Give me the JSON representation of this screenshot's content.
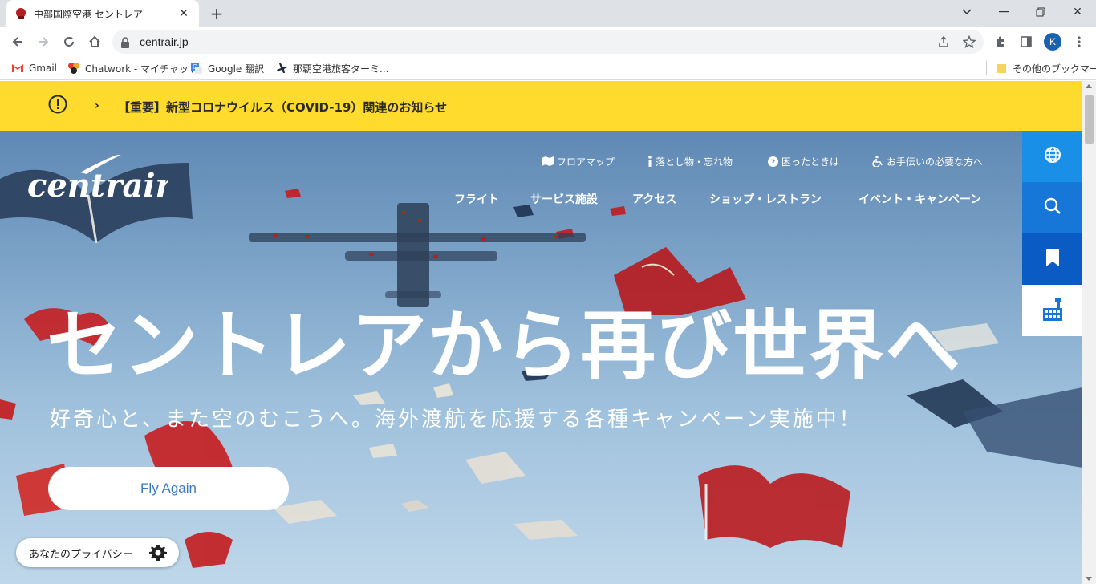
{
  "browser": {
    "tab_title": "中部国際空港 セントレア",
    "url": "centrair.jp",
    "profile_initial": "K"
  },
  "bookmarks": {
    "items": [
      {
        "label": "Gmail"
      },
      {
        "label": "Chatwork - マイチャット"
      },
      {
        "label": "Google 翻訳"
      },
      {
        "label": "那覇空港旅客ターミ..."
      }
    ],
    "other_label": "その他のブックマーク"
  },
  "notice": {
    "text": "【重要】新型コロナウイルス（COVID-19）関連のお知らせ"
  },
  "header": {
    "logo_text": "centrair",
    "utility_links": [
      {
        "label": "フロアマップ"
      },
      {
        "label": "落とし物・忘れ物"
      },
      {
        "label": "困ったときは"
      },
      {
        "label": "お手伝いの必要な方へ"
      }
    ],
    "main_nav": [
      {
        "label": "フライト"
      },
      {
        "label": "サービス施設"
      },
      {
        "label": "アクセス"
      },
      {
        "label": "ショップ・レストラン"
      },
      {
        "label": "イベント・キャンペーン"
      }
    ]
  },
  "hero": {
    "headline": "セントレアから再び世界へ",
    "subline": "好奇心と、また空のむこうへ。海外渡航を応援する各種キャンペーン実施中！",
    "cta_label": "Fly Again"
  },
  "privacy": {
    "label": "あなたのプライバシー"
  },
  "colors": {
    "notice_bg": "#fedb2c",
    "side_globe": "#1a8fe8",
    "side_search": "#1677d9",
    "side_bookmark": "#0a5bc4",
    "cta_text": "#3a79c8"
  }
}
